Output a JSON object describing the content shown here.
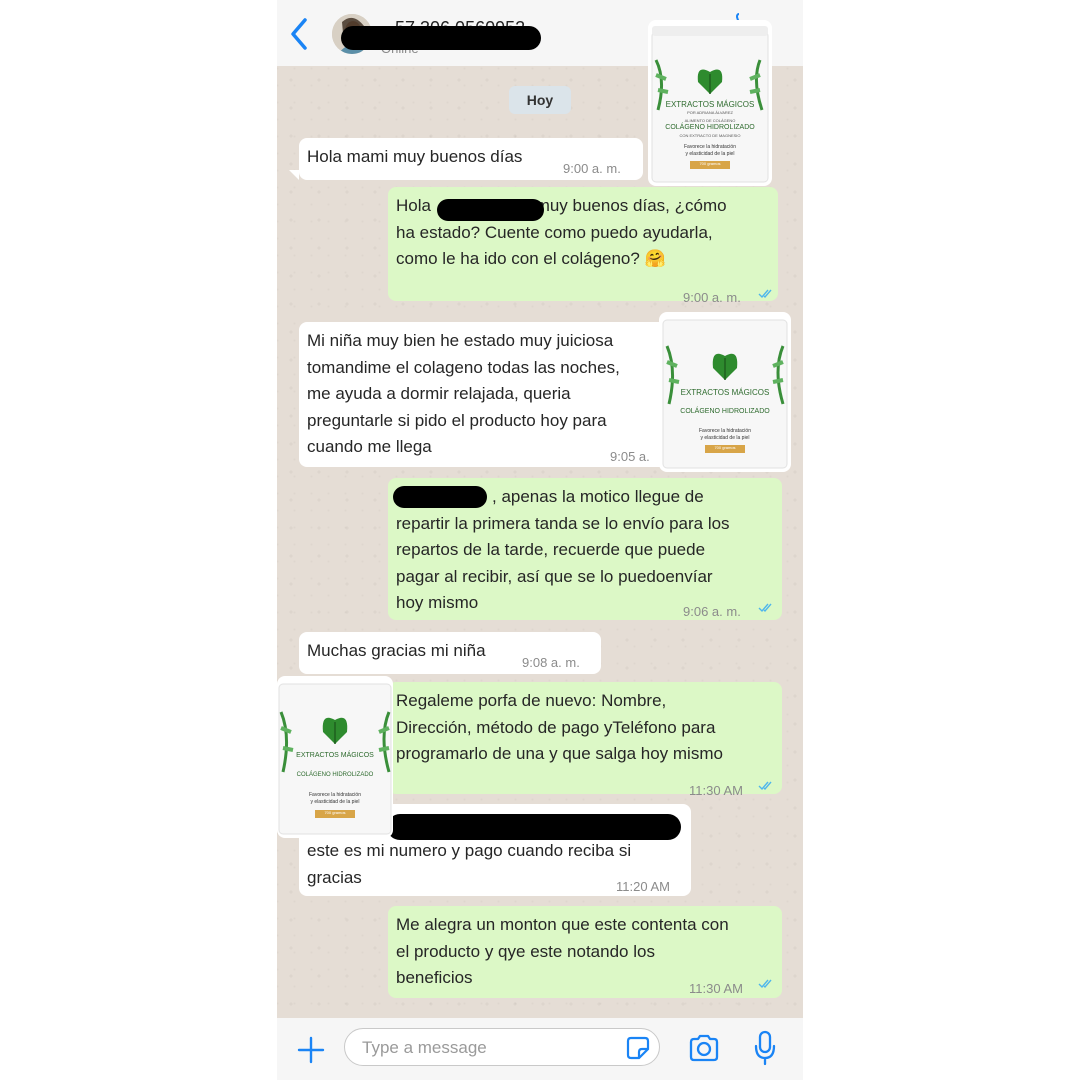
{
  "header": {
    "contact_name": "57 306 0560952",
    "contact_status": "Online",
    "back_icon": "chevron-left-icon",
    "accent_color": "#007aff"
  },
  "chat": {
    "day_label": "Hoy",
    "messages": [
      {
        "dir": "in",
        "text": "Hola mami muy buenos días",
        "time": "9:00 a. m."
      },
      {
        "dir": "out",
        "text_parts": [
          "Hola ",
          "muy buenos días, ¿cómo\nha estado? Cuente como puedo ayudarla,\ncomo le ha ido con el colágeno? 🤗"
        ],
        "time": "9:00 a. m."
      },
      {
        "dir": "in",
        "text": "Mi niña muy bien he estado muy juiciosa\ntomandime el colageno todas las noches,\nme ayuda a dormir relajada, queria\npreguntarle si pido el producto hoy para\ncuando me llega",
        "time": "9:05 a. m."
      },
      {
        "dir": "out",
        "text_parts": [
          ", apenas la motico llegue de",
          "repartir la primera tanda se lo envío para los\nrepartos de la tarde, recuerde que puede\npagar al recibir, así que se lo puedoenvíar\nhoy mismo"
        ],
        "time": "9:06 a. m."
      },
      {
        "dir": "in",
        "text": "Muchas gracias mi niña",
        "time": "9:08 a. m."
      },
      {
        "dir": "out",
        "text": "Regaleme porfa de nuevo: Nombre,\nDirección, método de pago yTeléfono para\nprogramarlo de una y que salga hoy mismo",
        "time": "11:30 AM"
      },
      {
        "dir": "in",
        "text": "este es mi numero y pago cuando reciba si\ngracias",
        "time": "11:20 AM"
      },
      {
        "dir": "out",
        "text": "Me alegra un monton que este contenta con\nel producto y qye este notando los\nbeneficios",
        "time": "11:30 AM"
      }
    ]
  },
  "product": {
    "brand": "EXTRACTOS MÁGICOS",
    "brand_sub": "POR ADRIANA ÁLVAREZ",
    "line1": "ALIMENTO DE COLÁGENO",
    "line2": "COLÁGENO HIDROLIZADO",
    "line3": "CON EXTRACTO DE MAGNESIO",
    "line4": "Favorece la hidratación",
    "line5": "y elasticidad de la piel",
    "weight": "700 gramos",
    "leaf_color": "#2e8b2e"
  },
  "composer": {
    "placeholder": "Type a message",
    "add_icon": "plus-icon",
    "sticker_icon": "sticker-icon",
    "camera_icon": "camera-icon",
    "mic_icon": "microphone-icon"
  },
  "colors": {
    "incoming_bubble": "#ffffff",
    "outgoing_bubble": "#dcf8c6",
    "read_ticks": "#4fb6ec"
  }
}
